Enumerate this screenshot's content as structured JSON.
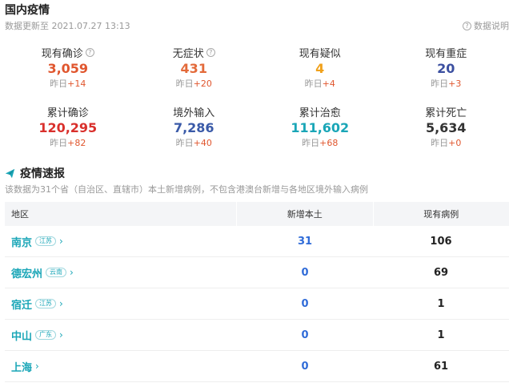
{
  "header": {
    "title": "国内疫情",
    "update_text": "数据更新至 2021.07.27 13:13",
    "explain_label": "数据说明"
  },
  "stats": [
    [
      {
        "label": "现有确诊",
        "value": "3,059",
        "delta_label": "昨日",
        "delta": "+14",
        "color": "#e0562e",
        "help": true
      },
      {
        "label": "无症状",
        "value": "431",
        "delta_label": "昨日",
        "delta": "+20",
        "color": "#e36a3a",
        "help": true
      },
      {
        "label": "现有疑似",
        "value": "4",
        "delta_label": "昨日",
        "delta": "+4",
        "color": "#f0a11b",
        "help": false
      },
      {
        "label": "现有重症",
        "value": "20",
        "delta_label": "昨日",
        "delta": "+3",
        "color": "#3b4fa0",
        "help": false
      }
    ],
    [
      {
        "label": "累计确诊",
        "value": "120,295",
        "delta_label": "昨日",
        "delta": "+82",
        "color": "#d9302c",
        "help": false
      },
      {
        "label": "境外输入",
        "value": "7,286",
        "delta_label": "昨日",
        "delta": "+40",
        "color": "#3a5aa8",
        "help": false
      },
      {
        "label": "累计治愈",
        "value": "111,602",
        "delta_label": "昨日",
        "delta": "+68",
        "color": "#1aa6b7",
        "help": false
      },
      {
        "label": "累计死亡",
        "value": "5,634",
        "delta_label": "昨日",
        "delta": "+0",
        "color": "#333333",
        "help": false
      }
    ]
  ],
  "news": {
    "title": "疫情速报",
    "note": "该数据为31个省（自治区、直辖市）本土新增病例，不包含港澳台新增与各地区境外输入病例"
  },
  "table": {
    "headers": {
      "area": "地区",
      "new_local": "新增本土",
      "current": "现有病例"
    },
    "rows": [
      {
        "region": "南京",
        "province": "江苏",
        "new_local": "31",
        "current": "106"
      },
      {
        "region": "德宏州",
        "province": "云南",
        "new_local": "0",
        "current": "69"
      },
      {
        "region": "宿迁",
        "province": "江苏",
        "new_local": "0",
        "current": "1"
      },
      {
        "region": "中山",
        "province": "广东",
        "new_local": "0",
        "current": "1"
      },
      {
        "region": "上海",
        "province": "",
        "new_local": "0",
        "current": "61"
      }
    ]
  },
  "icons": {
    "help": "question-circle-icon",
    "news": "paper-plane-icon",
    "chevron": "chevron-right-icon"
  },
  "colors": {
    "delta_positive": "#e0562e",
    "accent": "#1aa6b7",
    "new_local": "#2f6bd8"
  }
}
